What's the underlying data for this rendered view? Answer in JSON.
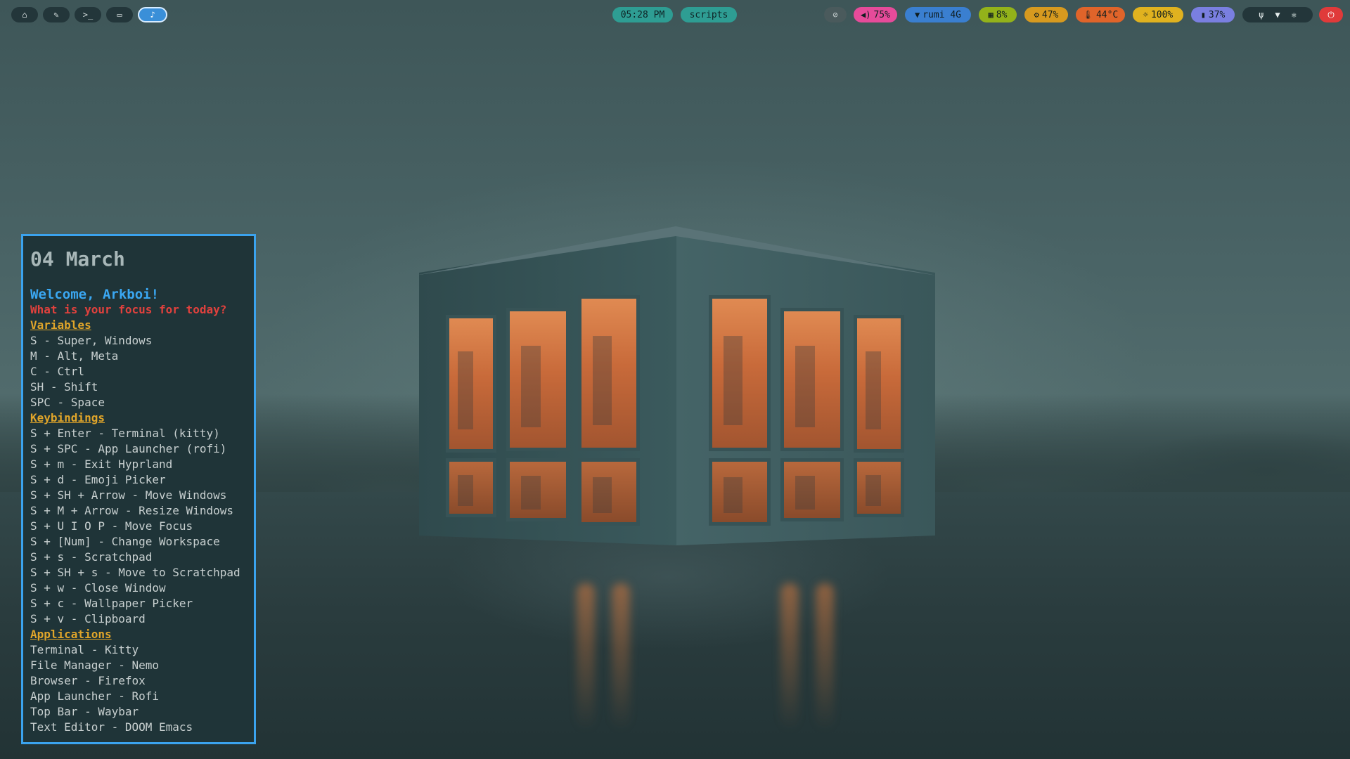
{
  "topbar": {
    "workspaces": [
      {
        "icon": "home-icon",
        "glyph": "⌂"
      },
      {
        "icon": "edit-icon",
        "glyph": "✎"
      },
      {
        "icon": "terminal-icon",
        "glyph": ">_"
      },
      {
        "icon": "chat-icon",
        "glyph": "▭"
      },
      {
        "icon": "music-icon",
        "glyph": "♪",
        "active": true
      }
    ],
    "clock": "05:28 PM",
    "scripts": "scripts",
    "indicators": [
      {
        "name": "notifications-off-icon",
        "glyph": "⊘",
        "text": "",
        "color": "#4a5a5c"
      },
      {
        "name": "volume-icon",
        "glyph": "◀)",
        "text": "75%",
        "color": "#e64b9a"
      },
      {
        "name": "wifi-icon",
        "glyph": "▼",
        "text": "rumi 4G",
        "color": "#3a7fd0"
      },
      {
        "name": "memory-icon",
        "glyph": "▦",
        "text": "8%",
        "color": "#93b21a"
      },
      {
        "name": "cpu-icon",
        "glyph": "⚙",
        "text": "47%",
        "color": "#d79a1f"
      },
      {
        "name": "temperature-icon",
        "glyph": "🌡",
        "text": "44°C",
        "color": "#e0642a"
      },
      {
        "name": "brightness-icon",
        "glyph": "☼",
        "text": "100%",
        "color": "#e0b21f"
      },
      {
        "name": "battery-icon",
        "glyph": "▮",
        "text": "37%",
        "color": "#7a7fe0"
      }
    ],
    "tray": [
      "usb-icon",
      "wifi-tray-icon",
      "bluetooth-icon"
    ],
    "power_glyph": "⏻"
  },
  "panel": {
    "date": "04 March",
    "welcome": "Welcome, Arkboi!",
    "focus": "What is your focus for today?",
    "sections": [
      {
        "heading": "Variables",
        "items": [
          "S - Super, Windows",
          "M - Alt, Meta",
          "C - Ctrl",
          "SH - Shift",
          "SPC - Space"
        ]
      },
      {
        "heading": "Keybindings",
        "items": [
          "S + Enter - Terminal (kitty)",
          "S + SPC - App Launcher (rofi)",
          "S + m - Exit Hyprland",
          "S + d - Emoji Picker",
          "S + SH + Arrow - Move Windows",
          "S + M + Arrow - Resize Windows",
          "S + U I O P - Move Focus",
          "S + [Num] - Change Workspace",
          "S + s - Scratchpad",
          "S + SH + s - Move to Scratchpad",
          "S + w - Close Window",
          "S + c - Wallpaper Picker",
          "S + v - Clipboard"
        ]
      },
      {
        "heading": "Applications",
        "items": [
          "Terminal - Kitty",
          "File Manager - Nemo",
          "Browser - Firefox",
          "App Launcher - Rofi",
          "Top Bar - Waybar",
          "Text Editor - DOOM Emacs"
        ]
      }
    ]
  }
}
